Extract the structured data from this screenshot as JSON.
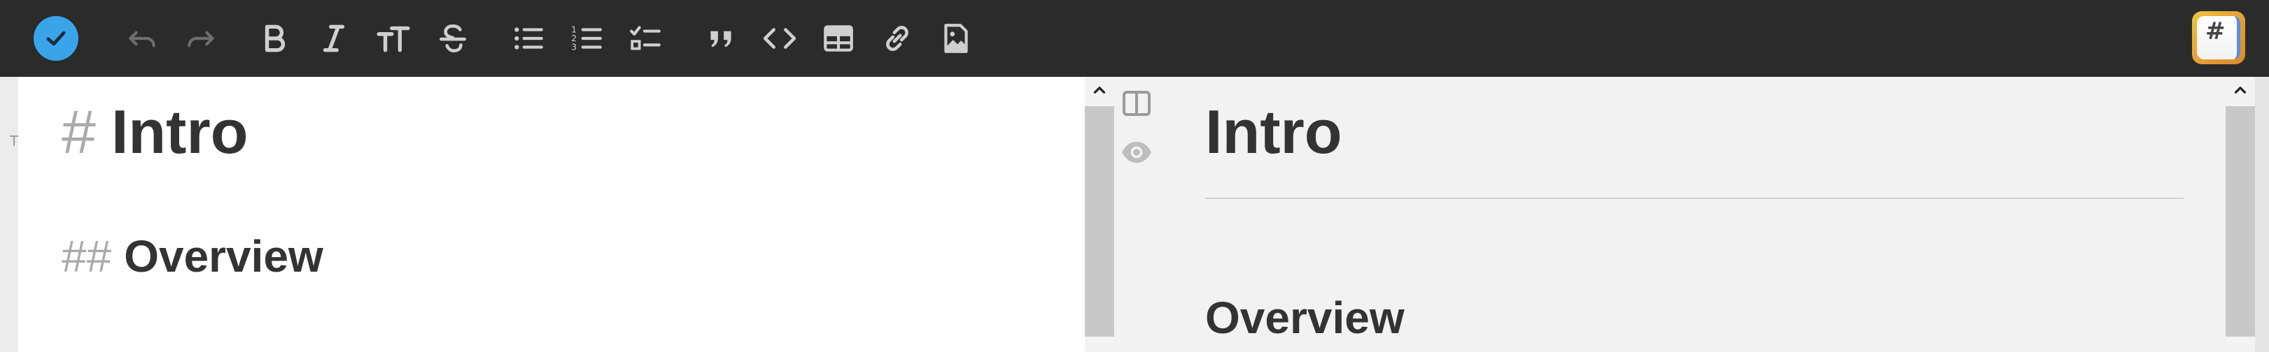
{
  "toolbar": {
    "done_button": "done",
    "icons": [
      "checkmark-icon",
      "undo-icon",
      "redo-icon",
      "bold-icon",
      "italic-icon",
      "heading-icon",
      "strikethrough-icon",
      "bullet-list-icon",
      "numbered-list-icon",
      "checklist-icon",
      "quote-icon",
      "code-icon",
      "table-icon",
      "link-icon",
      "image-icon"
    ],
    "accent_color": "#3aa4ea",
    "background_color": "#2b2b2b",
    "app_badge_symbol": "#"
  },
  "left_strip": {
    "text": "T"
  },
  "editor": {
    "lines": [
      {
        "marker": "#",
        "text": "Intro"
      },
      {
        "marker": "##",
        "text": "Overview"
      }
    ]
  },
  "preview": {
    "heading1": "Intro",
    "heading2": "Overview",
    "tools": [
      "split-view-icon",
      "eye-icon"
    ]
  }
}
